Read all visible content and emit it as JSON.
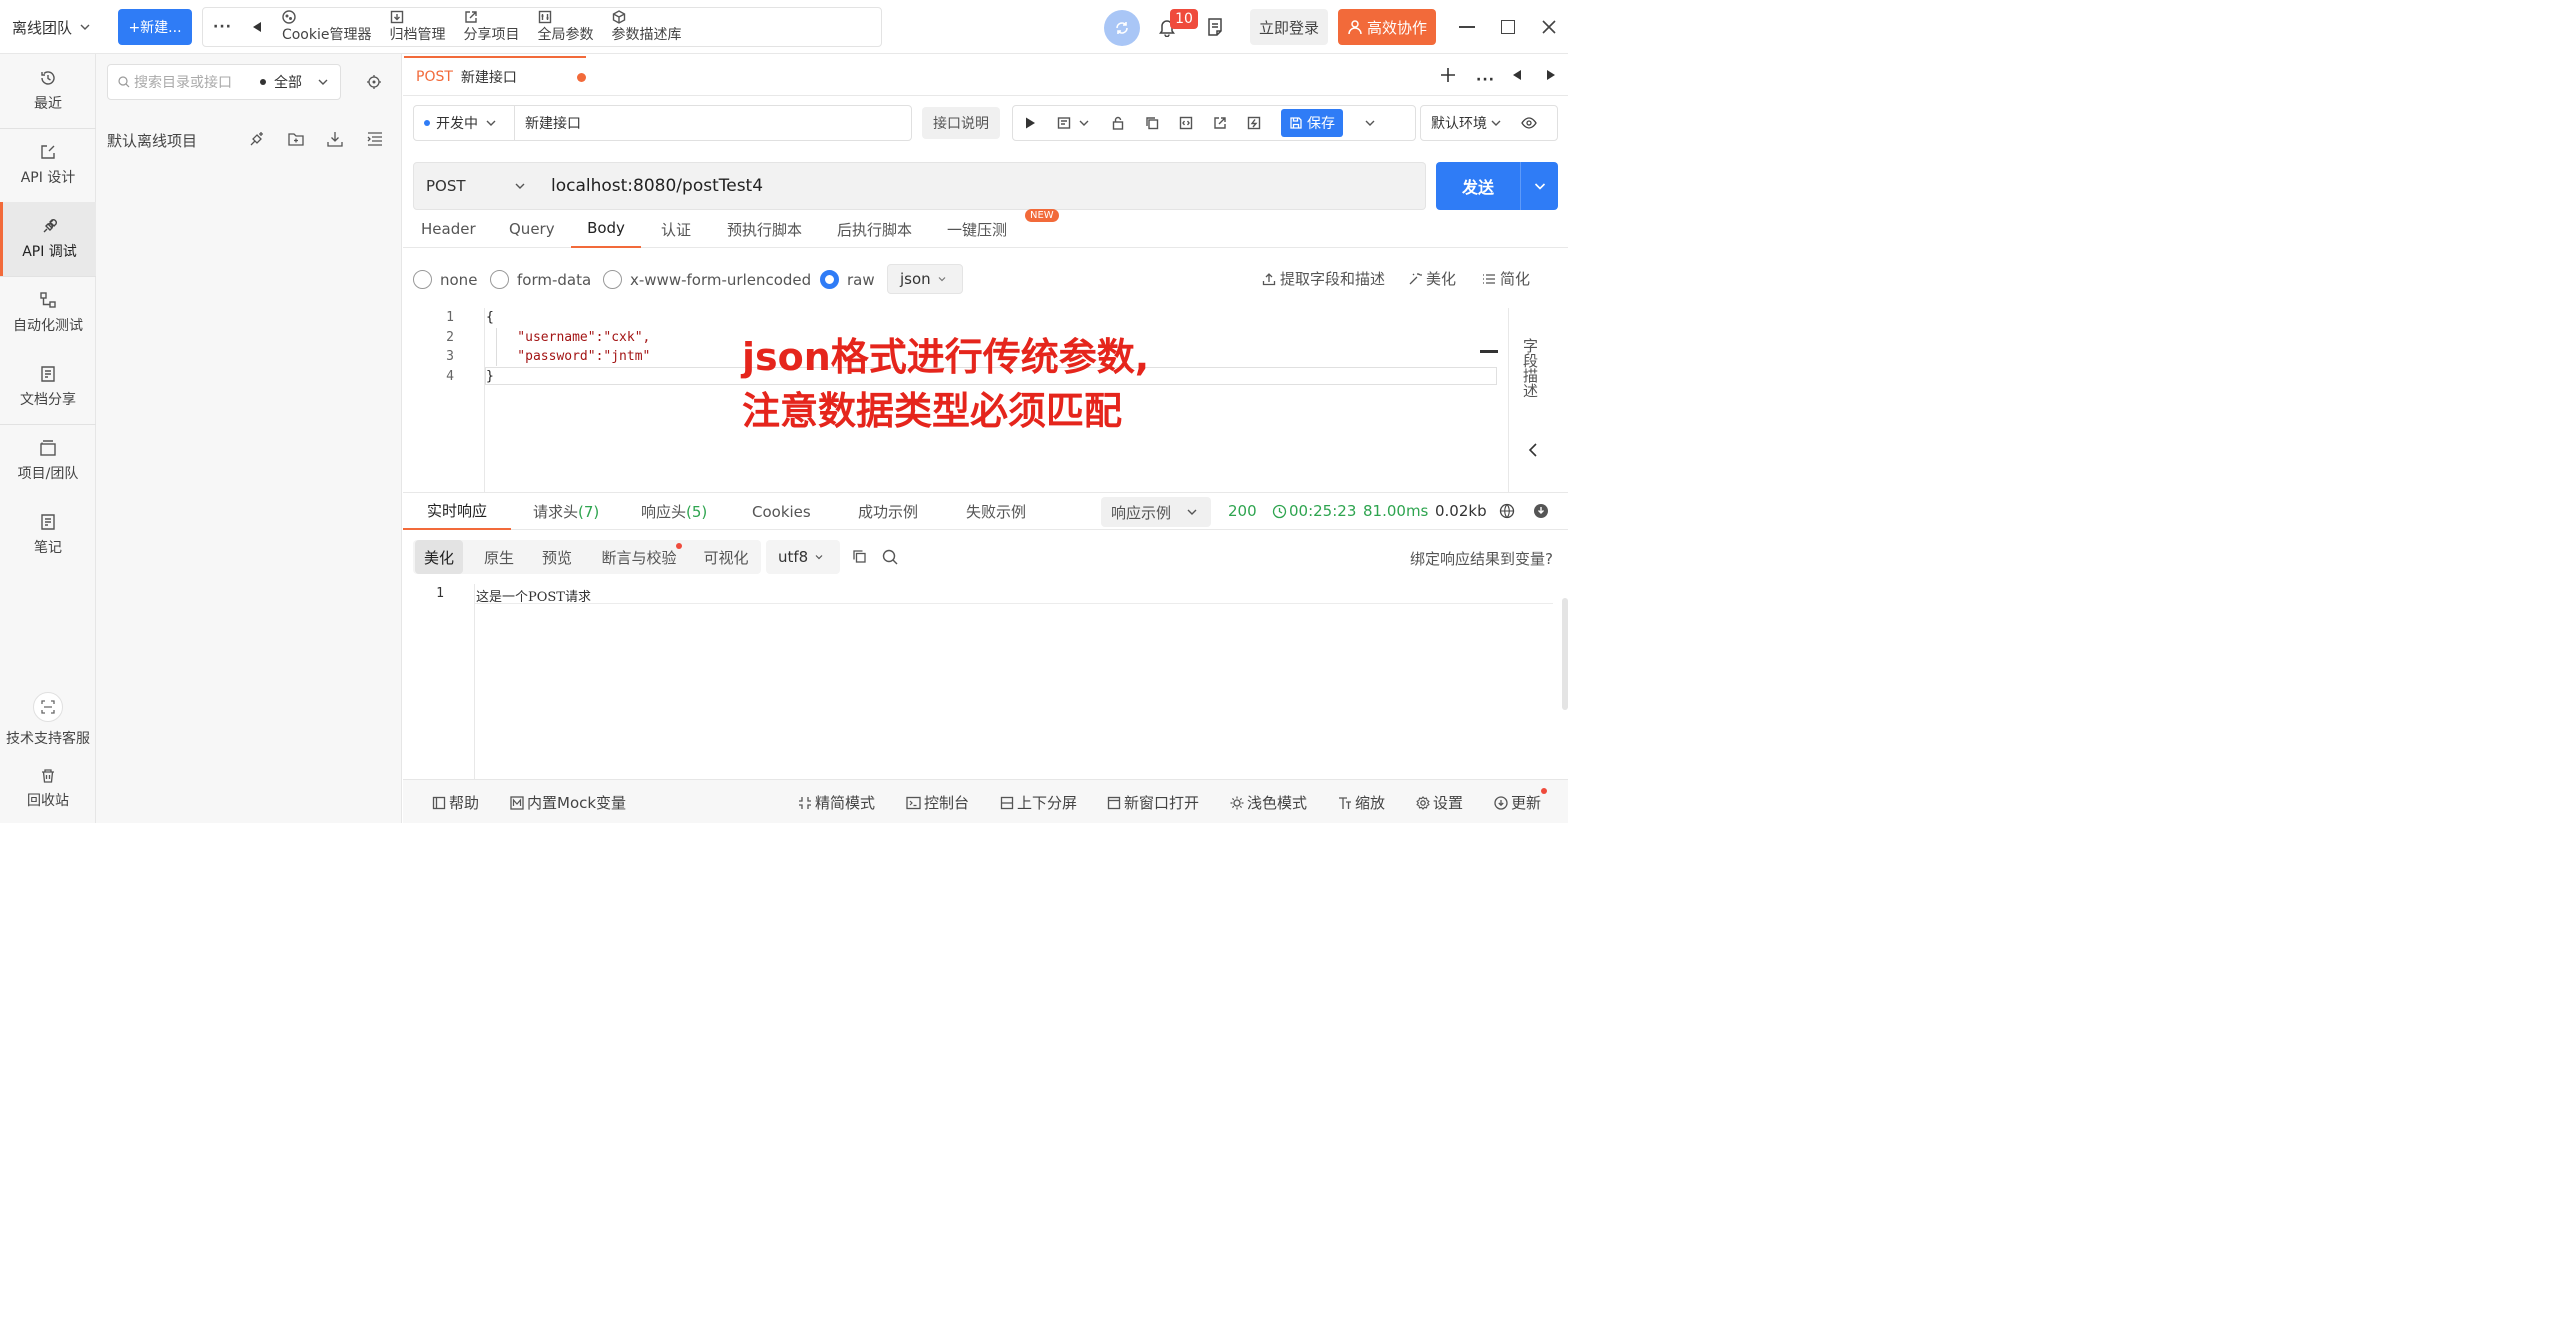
{
  "topbar": {
    "team": "离线团队",
    "new_label": "+新建...",
    "more": "···",
    "tools": [
      "Cookie管理器",
      "归档管理",
      "分享项目",
      "全局参数",
      "参数描述库"
    ],
    "notification_count": "10",
    "login": "立即登录",
    "collab": "高效协作"
  },
  "leftnav": {
    "items": [
      "最近",
      "API 设计",
      "API 调试",
      "自动化测试",
      "文档分享",
      "项目/团队",
      "笔记"
    ],
    "support": "技术支持客服",
    "trash": "回收站"
  },
  "dirpanel": {
    "search_placeholder": "搜索目录或接口",
    "filter": "全部",
    "project": "默认离线项目"
  },
  "doc_tab": {
    "method": "POST",
    "name": "新建接口"
  },
  "request": {
    "status": "开发中",
    "name": "新建接口",
    "desc_btn": "接口说明",
    "save": "保存",
    "env": "默认环境",
    "method": "POST",
    "url": "localhost:8080/postTest4",
    "send": "发送"
  },
  "req_tabs": [
    "Header",
    "Query",
    "Body",
    "认证",
    "预执行脚本",
    "后执行脚本",
    "一键压测"
  ],
  "new_badge": "NEW",
  "body": {
    "types": [
      "none",
      "form-data",
      "x-www-form-urlencoded",
      "raw"
    ],
    "format": "json",
    "tools": [
      "提取字段和描述",
      "美化",
      "简化"
    ],
    "lines": [
      "{",
      "    \"username\":\"cxk\",",
      "    \"password\":\"jntm\"",
      "}"
    ],
    "line_numbers": [
      "1",
      "2",
      "3",
      "4"
    ],
    "side_label": "字段描述"
  },
  "annotation": [
    "json格式进行传统参数,",
    "注意数据类型必须匹配"
  ],
  "response": {
    "tabs": [
      "实时响应",
      "请求头",
      "响应头",
      "Cookies",
      "成功示例",
      "失败示例"
    ],
    "req_header_count": "(7)",
    "resp_header_count": "(5)",
    "example": "响应示例",
    "status": "200",
    "time": "00:25:23",
    "duration": "81.00ms",
    "size": "0.02kb",
    "views": [
      "美化",
      "原生",
      "预览",
      "断言与校验",
      "可视化"
    ],
    "encoding": "utf8",
    "bind": "绑定响应结果到变量?",
    "line_number": "1",
    "body_text": "这是一个POST请求"
  },
  "footer": {
    "left": [
      "帮助",
      "内置Mock变量"
    ],
    "right": [
      "精简模式",
      "控制台",
      "上下分屏",
      "新窗口打开",
      "浅色模式",
      "缩放",
      "设置",
      "更新"
    ]
  },
  "colors": {
    "accent": "#f26a3a",
    "primary": "#2f7cf6",
    "success": "#2ea44f",
    "annotation": "#e5251c"
  }
}
